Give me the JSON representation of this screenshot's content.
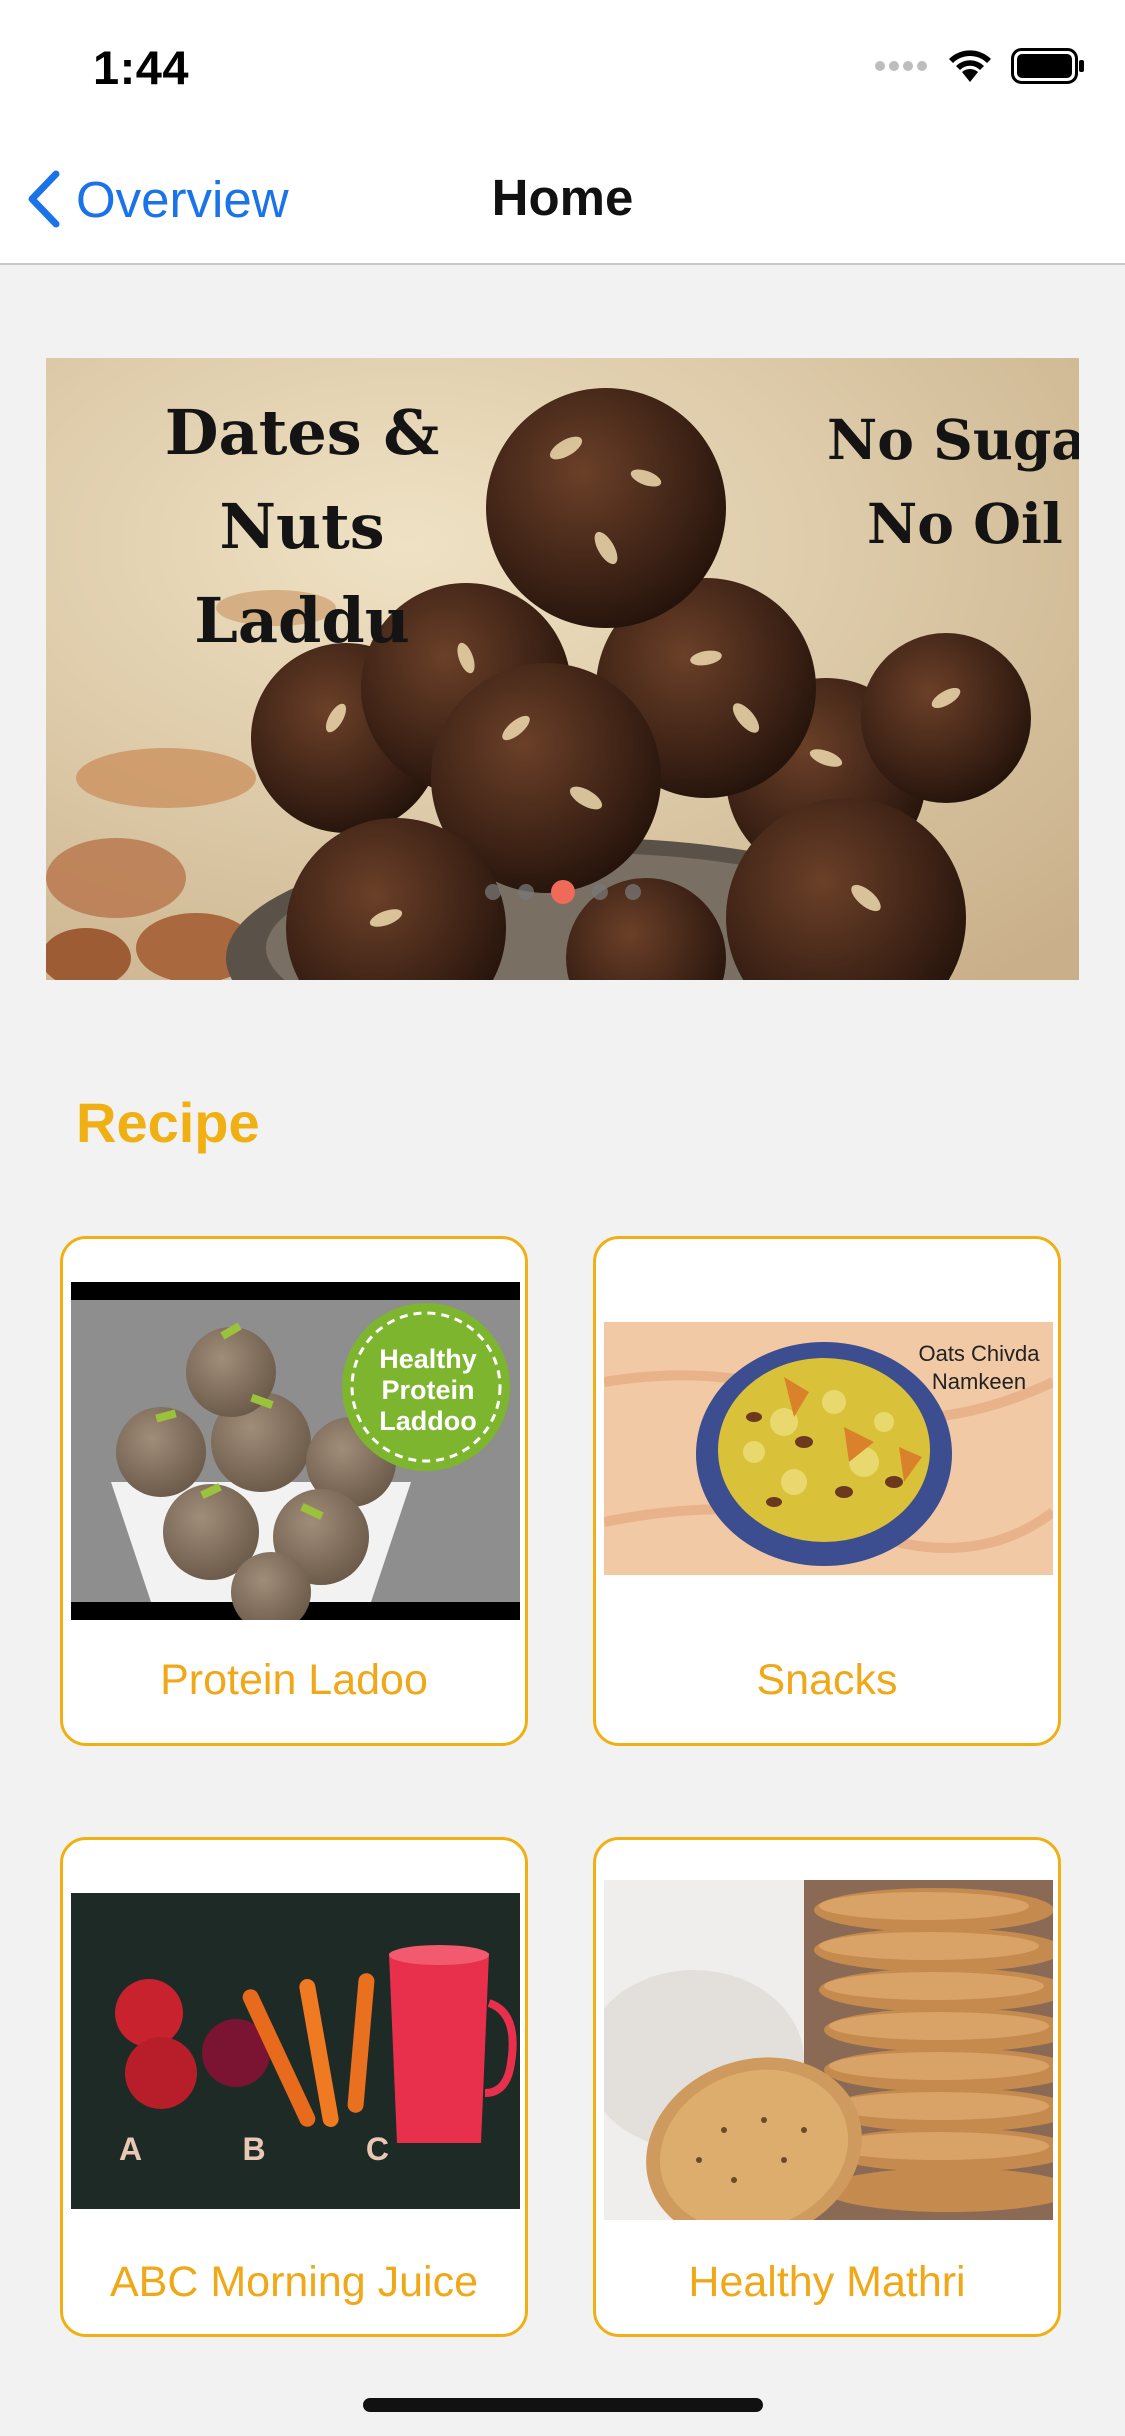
{
  "status_bar": {
    "time": "1:44"
  },
  "nav": {
    "back_label": "Overview",
    "title": "Home"
  },
  "banner": {
    "title_line1": "Dates & Nuts",
    "title_line2": "Laddu",
    "tag_line1": "No Suga",
    "tag_line2": "No Oil",
    "page_count": 5,
    "active_page": 2
  },
  "section": {
    "title": "Recipe"
  },
  "cards": [
    {
      "label": "Protein Ladoo",
      "badge_lines": [
        "Healthy",
        "Protein",
        "Laddoo"
      ]
    },
    {
      "label": "Snacks",
      "overlay_lines": [
        "Oats Chivda",
        "Namkeen"
      ]
    },
    {
      "label": "ABC  Morning Juice",
      "letters": [
        "A",
        "B",
        "C"
      ]
    },
    {
      "label": "Healthy Mathri"
    }
  ],
  "colors": {
    "accent": "#F0B014",
    "link": "#1A73E8",
    "active_dot": "#F06A5A",
    "background": "#F2F2F2"
  }
}
